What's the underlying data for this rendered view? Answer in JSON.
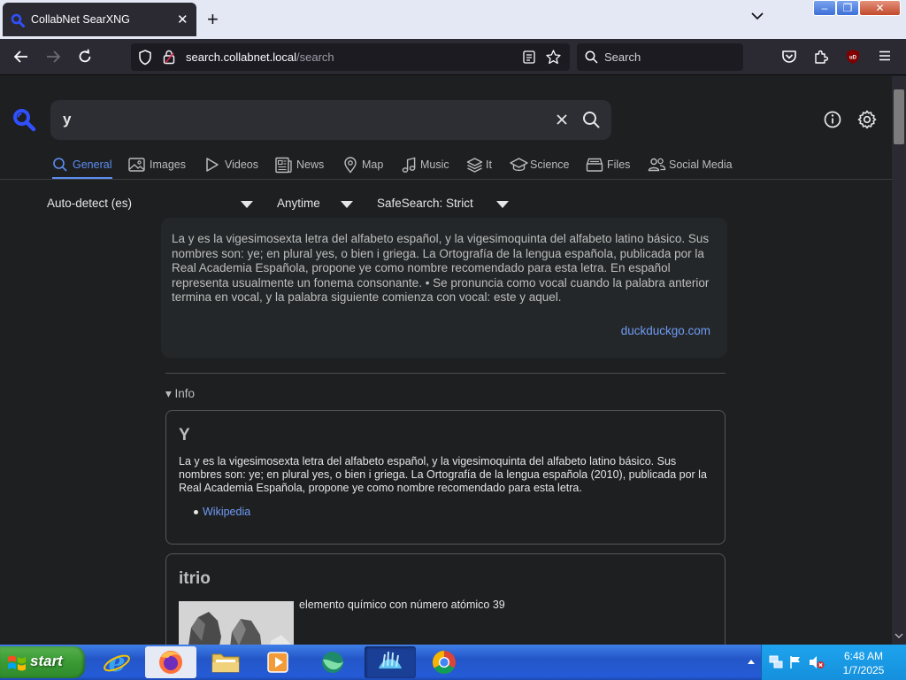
{
  "browser": {
    "tab_title": "CollabNet SearXNG",
    "tab_close": "✕",
    "new_tab": "+",
    "url_host": "search.collabnet.local",
    "url_path": "/search",
    "search_placeholder": "Search",
    "window_buttons": {
      "minimize": "–",
      "maximize": "❐",
      "close": "✕"
    }
  },
  "search": {
    "query": "y"
  },
  "categories": [
    {
      "label": "General",
      "icon": "search-icon",
      "active": true
    },
    {
      "label": "Images",
      "icon": "image-icon"
    },
    {
      "label": "Videos",
      "icon": "play-icon"
    },
    {
      "label": "News",
      "icon": "newspaper-icon"
    },
    {
      "label": "Map",
      "icon": "map-pin-icon"
    },
    {
      "label": "Music",
      "icon": "music-icon"
    },
    {
      "label": "It",
      "icon": "layers-icon"
    },
    {
      "label": "Science",
      "icon": "school-icon"
    },
    {
      "label": "Files",
      "icon": "file-tray-icon"
    },
    {
      "label": "Social Media",
      "icon": "people-icon"
    }
  ],
  "filters": {
    "language": "Auto-detect (es)",
    "time_range": "Anytime",
    "safesearch": "SafeSearch: Strict"
  },
  "answer": {
    "text": "La y es la vigesimosexta letra del alfabeto español, y la vigesimoquinta del alfabeto latino básico. Sus nombres son: ye; en plural yes, o bien i griega. La Ortografía de la lengua española, publicada por la Real Academia Española, propone ye como nombre recomendado para esta letra. En español representa usualmente un fonema consonante. • Se pronuncia como vocal cuando la palabra anterior termina en vocal, y la palabra siguiente comienza con vocal: este y aquel.",
    "source": "duckduckgo.com"
  },
  "info_toggle": "▾ Info",
  "infoboxes": [
    {
      "title": "Y",
      "description": "La y es la vigesimosexta letra del alfabeto español, y la vigesimoquinta del alfabeto latino básico. Sus nombres son: ye; en plural yes, o bien i griega. La Ortografía de la lengua española (2010), publicada por la Real Academia Española, propone ye como nombre recomendado para esta letra.",
      "links": [
        "Wikipedia"
      ]
    },
    {
      "title": "itrio",
      "description": "elemento químico con número atómico 39"
    }
  ],
  "taskbar": {
    "start_label": "start",
    "clock_time": "6:48 AM",
    "clock_date": "1/7/2025"
  },
  "colors": {
    "accent": "#5c8ef0",
    "link": "#6f9cf5",
    "page_bg": "#1e1f21"
  }
}
